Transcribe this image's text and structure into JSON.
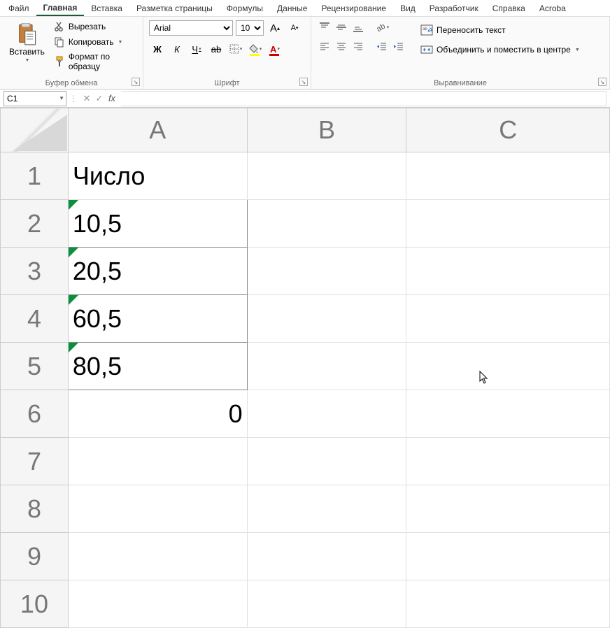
{
  "menu": {
    "items": [
      "Файл",
      "Главная",
      "Вставка",
      "Разметка страницы",
      "Формулы",
      "Данные",
      "Рецензирование",
      "Вид",
      "Разработчик",
      "Справка",
      "Acroba"
    ],
    "active": 1
  },
  "ribbon": {
    "clipboard": {
      "paste": "Вставить",
      "cut": "Вырезать",
      "copy": "Копировать",
      "format_painter": "Формат по образцу",
      "label": "Буфер обмена"
    },
    "font": {
      "name": "Arial",
      "size": "10",
      "label": "Шрифт"
    },
    "alignment": {
      "wrap": "Переносить текст",
      "merge": "Объединить и поместить в центре",
      "label": "Выравнивание"
    }
  },
  "name_box": "C1",
  "formula": "",
  "columns": [
    "A",
    "B",
    "C"
  ],
  "rows": [
    "1",
    "2",
    "3",
    "4",
    "5",
    "6",
    "7",
    "8",
    "9",
    "10"
  ],
  "cells": {
    "A1": {
      "v": "Число",
      "align": "left",
      "border": false,
      "err": false
    },
    "A2": {
      "v": "10,5",
      "align": "left",
      "border": true,
      "err": true
    },
    "A3": {
      "v": "20,5",
      "align": "left",
      "border": true,
      "err": true
    },
    "A4": {
      "v": "60,5",
      "align": "left",
      "border": true,
      "err": true
    },
    "A5": {
      "v": "80,5",
      "align": "left",
      "border": true,
      "err": true
    },
    "A6": {
      "v": "0",
      "align": "right",
      "border": false,
      "err": false
    }
  }
}
